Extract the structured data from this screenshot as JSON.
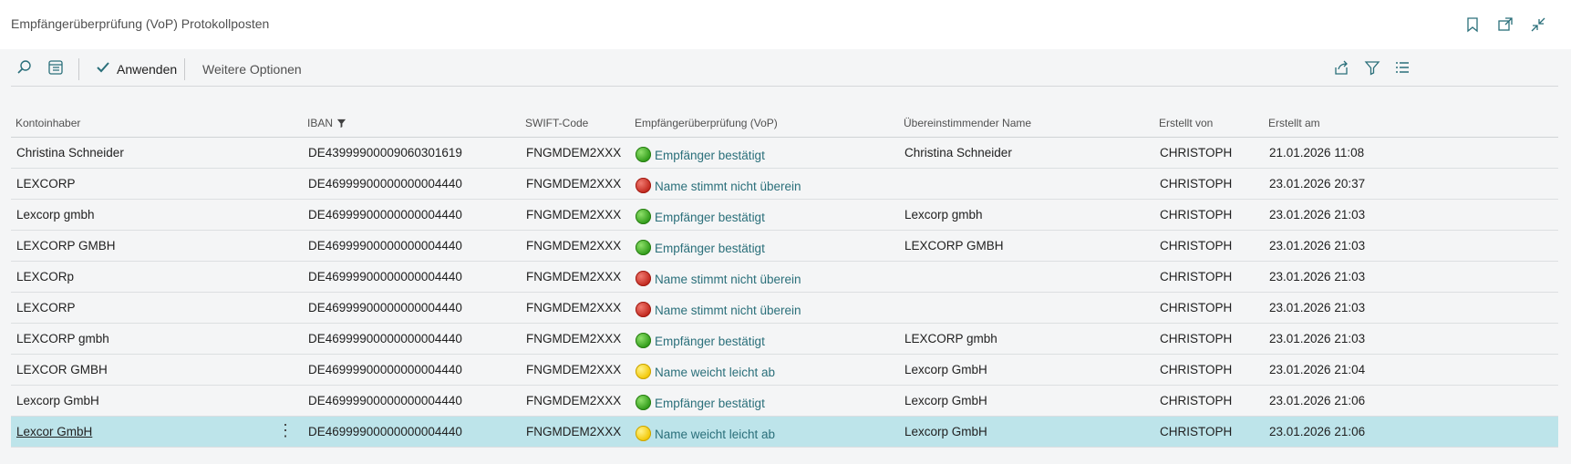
{
  "header": {
    "title": "Empfängerüberprüfung (VoP) Protokollposten"
  },
  "toolbar": {
    "apply_label": "Anwenden",
    "more_options_label": "Weitere Optionen"
  },
  "columns": [
    "Kontoinhaber",
    "IBAN",
    "SWIFT-Code",
    "Empfängerüberprüfung (VoP)",
    "Übereinstimmender Name",
    "Erstellt von",
    "Erstellt am"
  ],
  "rows": [
    {
      "holder": "Christina Schneider",
      "iban": "DE43999900009060301619",
      "swift": "FNGMDEM2XXX",
      "status": "green",
      "vop": "Empfänger bestätigt",
      "matched": "Christina Schneider",
      "by": "CHRISTOPH",
      "at": "21.01.2026 11:08"
    },
    {
      "holder": "LEXCORP",
      "iban": "DE46999900000000004440",
      "swift": "FNGMDEM2XXX",
      "status": "red",
      "vop": "Name stimmt nicht überein",
      "matched": "",
      "by": "CHRISTOPH",
      "at": "23.01.2026 20:37"
    },
    {
      "holder": "Lexcorp gmbh",
      "iban": "DE46999900000000004440",
      "swift": "FNGMDEM2XXX",
      "status": "green",
      "vop": "Empfänger bestätigt",
      "matched": "Lexcorp gmbh",
      "by": "CHRISTOPH",
      "at": "23.01.2026 21:03"
    },
    {
      "holder": "LEXCORP GMBH",
      "iban": "DE46999900000000004440",
      "swift": "FNGMDEM2XXX",
      "status": "green",
      "vop": "Empfänger bestätigt",
      "matched": "LEXCORP GMBH",
      "by": "CHRISTOPH",
      "at": "23.01.2026 21:03"
    },
    {
      "holder": "LEXCORp",
      "iban": "DE46999900000000004440",
      "swift": "FNGMDEM2XXX",
      "status": "red",
      "vop": "Name stimmt nicht überein",
      "matched": "",
      "by": "CHRISTOPH",
      "at": "23.01.2026 21:03"
    },
    {
      "holder": "LEXCORP",
      "iban": "DE46999900000000004440",
      "swift": "FNGMDEM2XXX",
      "status": "red",
      "vop": "Name stimmt nicht überein",
      "matched": "",
      "by": "CHRISTOPH",
      "at": "23.01.2026 21:03"
    },
    {
      "holder": "LEXCORP gmbh",
      "iban": "DE46999900000000004440",
      "swift": "FNGMDEM2XXX",
      "status": "green",
      "vop": "Empfänger bestätigt",
      "matched": "LEXCORP gmbh",
      "by": "CHRISTOPH",
      "at": "23.01.2026 21:03"
    },
    {
      "holder": "LEXCOR GMBH",
      "iban": "DE46999900000000004440",
      "swift": "FNGMDEM2XXX",
      "status": "yellow",
      "vop": "Name weicht leicht ab",
      "matched": "Lexcorp GmbH",
      "by": "CHRISTOPH",
      "at": "23.01.2026 21:04"
    },
    {
      "holder": "Lexcorp GmbH",
      "iban": "DE46999900000000004440",
      "swift": "FNGMDEM2XXX",
      "status": "green",
      "vop": "Empfänger bestätigt",
      "matched": "Lexcorp GmbH",
      "by": "CHRISTOPH",
      "at": "23.01.2026 21:06"
    },
    {
      "holder": "Lexcor GmbH",
      "iban": "DE46999900000000004440",
      "swift": "FNGMDEM2XXX",
      "status": "yellow",
      "vop": "Name weicht leicht ab",
      "matched": "Lexcorp GmbH",
      "by": "CHRISTOPH",
      "at": "23.01.2026 21:06",
      "selected": true
    }
  ],
  "colors": {
    "accent": "#2a6f7a",
    "selected_row": "#bde4ea",
    "green": "#2f9a18",
    "red": "#c0261c",
    "yellow": "#f2c600"
  },
  "icons": [
    "bookmark-icon",
    "open-new-window-icon",
    "collapse-icon",
    "search-icon",
    "edit-list-icon",
    "checkmark-icon",
    "share-icon",
    "filter-icon",
    "list-view-icon",
    "more-actions-icon",
    "column-filter-icon"
  ]
}
